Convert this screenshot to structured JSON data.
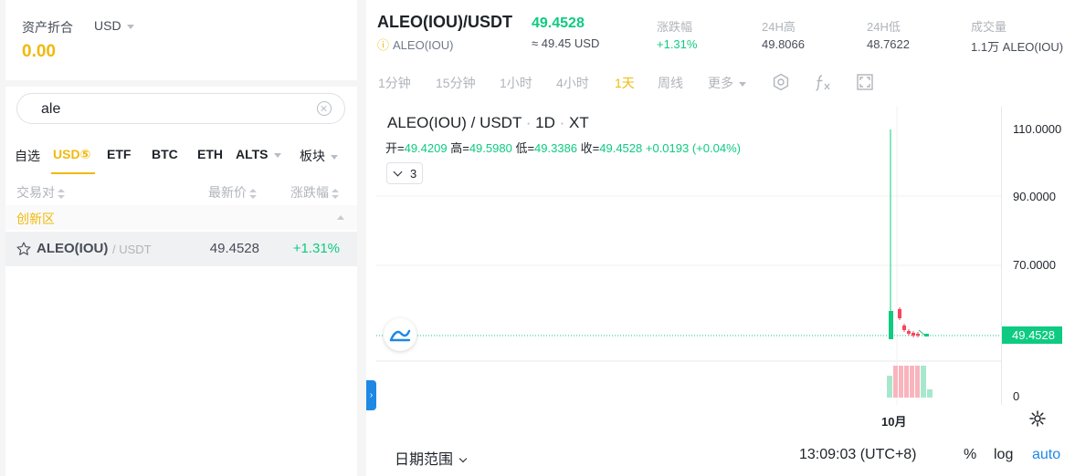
{
  "asset": {
    "label": "资产折合",
    "currency": "USD",
    "value": "0.00"
  },
  "search": {
    "value": "ale"
  },
  "market_tabs": [
    {
      "label": "自选"
    },
    {
      "label": "USD⑤"
    },
    {
      "label": "ETF"
    },
    {
      "label": "BTC"
    },
    {
      "label": "ETH"
    },
    {
      "label": "ALTS"
    },
    {
      "label": "板块"
    }
  ],
  "columns": {
    "pair": "交易对",
    "price": "最新价",
    "change": "涨跌幅"
  },
  "section": {
    "label": "创新区"
  },
  "pairs": [
    {
      "base": "ALEO(IOU)",
      "quote": "/ USDT",
      "price": "49.4528",
      "change": "+1.31%"
    }
  ],
  "ticker": {
    "symbol": "ALEO(IOU)/USDT",
    "price": "49.4528",
    "name": "ALEO(IOU)",
    "approx": "≈ 49.45 USD"
  },
  "stats": [
    {
      "label": "涨跌幅",
      "value": "+1.31%"
    },
    {
      "label": "24H高",
      "value": "49.8066"
    },
    {
      "label": "24H低",
      "value": "48.7622"
    },
    {
      "label": "成交量",
      "value": "1.1万 ALEO(IOU)"
    }
  ],
  "timeframes": [
    {
      "label": "1分钟"
    },
    {
      "label": "15分钟"
    },
    {
      "label": "1小时"
    },
    {
      "label": "4小时"
    },
    {
      "label": "1天"
    },
    {
      "label": "周线"
    },
    {
      "label": "更多"
    }
  ],
  "legend": {
    "pair": "ALEO(IOU) / USDT",
    "interval": "1D",
    "exchange": "XT",
    "open_label": "开=",
    "open": "49.4209",
    "high_label": "高=",
    "high": "49.5980",
    "low_label": "低=",
    "low": "49.3386",
    "close_label": "收=",
    "close": "49.4528",
    "change": "+0.0193 (+0.04%)",
    "indicators_count": "3"
  },
  "yaxis": {
    "ticks": [
      "110.0000",
      "90.0000",
      "70.0000"
    ],
    "volume_tick": "0",
    "last_price": "49.4528"
  },
  "xaxis": {
    "label": "10月"
  },
  "bottom": {
    "range_label": "日期范围",
    "time": "13:09:03 (UTC+8)",
    "percent": "%",
    "log": "log",
    "auto": "auto"
  },
  "colors": {
    "brand": "#f0b90b",
    "up": "#0ecb81",
    "down": "#f6465d",
    "accent": "#1e88e5"
  }
}
